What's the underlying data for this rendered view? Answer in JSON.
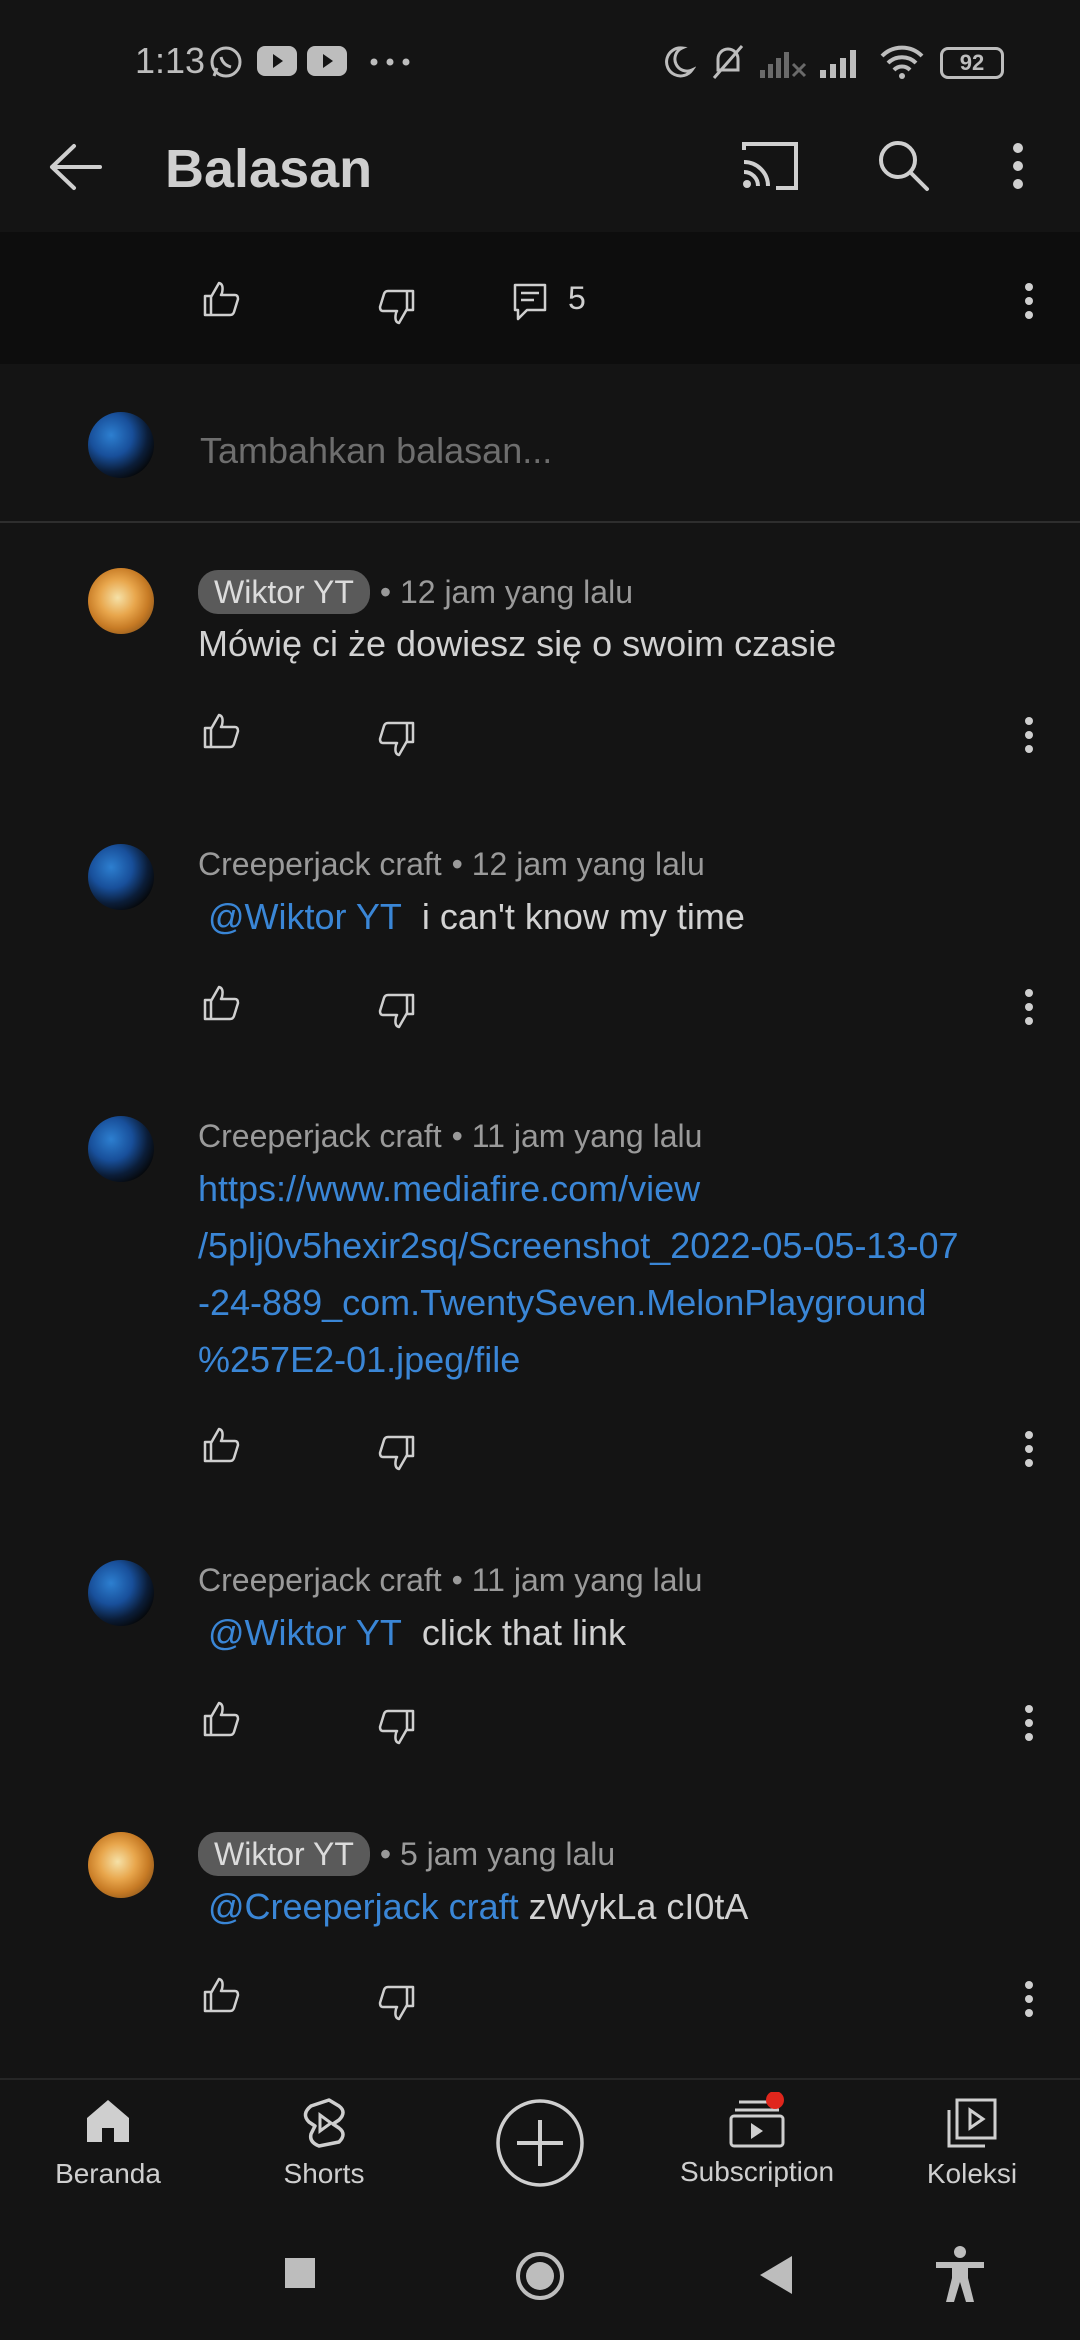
{
  "status_bar": {
    "time": "1:13",
    "battery": "92"
  },
  "app_bar": {
    "title": "Balasan"
  },
  "parent_comment": {
    "reply_count": "5"
  },
  "reply_box": {
    "placeholder": "Tambahkan balasan..."
  },
  "comments": [
    {
      "author": "Wiktor YT",
      "time": "• 12 jam yang lalu",
      "text": "Mówię ci że dowiesz się o swoim czasie"
    },
    {
      "author": "Creeperjack craft",
      "time": "• 12 jam yang lalu",
      "mention": "@Wiktor YT",
      "text": "i can't know my time"
    },
    {
      "author": "Creeperjack craft",
      "time": "• 11 jam yang lalu",
      "link_lines": [
        "https://www.mediafire.com/view",
        "/5plj0v5hexir2sq/Screenshot_2022-05-05-13-07",
        "-24-889_com.TwentySeven.MelonPlayground",
        "%257E2-01.jpeg/file"
      ]
    },
    {
      "author": "Creeperjack craft",
      "time": "• 11 jam yang lalu",
      "mention": "@Wiktor YT",
      "text": "click that link"
    },
    {
      "author": "Wiktor YT",
      "time": "• 5 jam yang lalu",
      "mention": "@Creeperjack craft",
      "text": "zWykLa cI0tA"
    }
  ],
  "bottom_nav": {
    "home": "Beranda",
    "shorts": "Shorts",
    "subscription": "Subscription",
    "library": "Koleksi"
  },
  "colors": {
    "background": "#141414",
    "link": "#3a86d6",
    "chip": "#5a5a5a",
    "notification_dot": "#e0261c"
  }
}
